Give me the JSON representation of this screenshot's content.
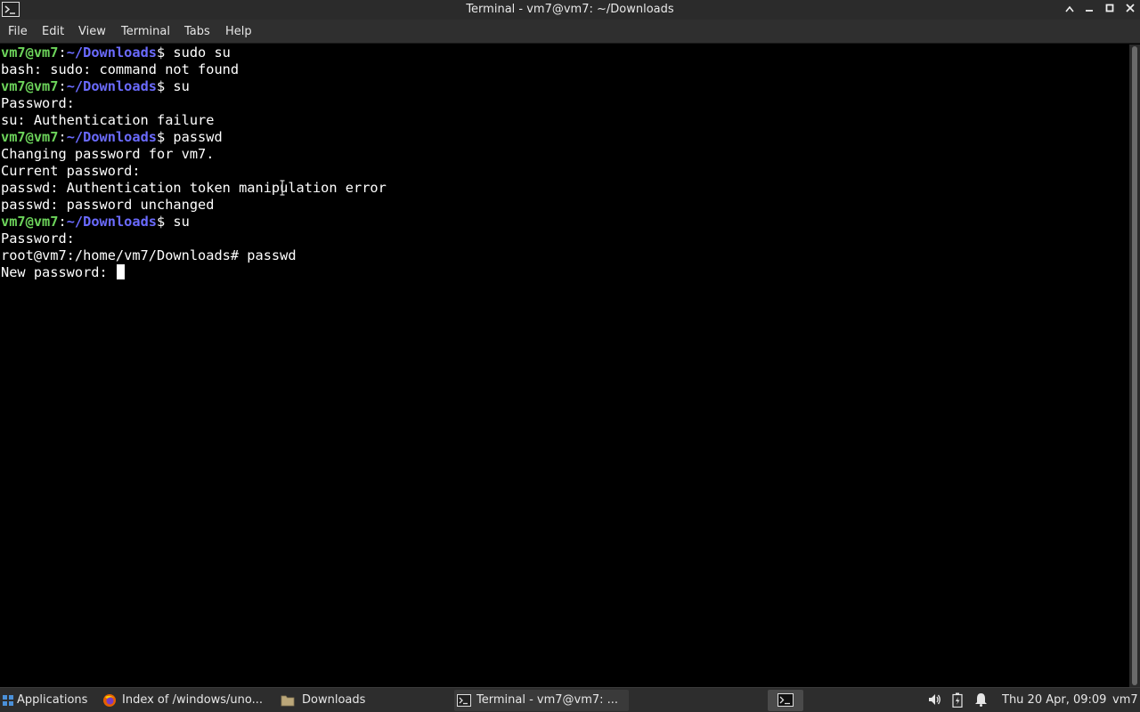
{
  "window": {
    "title": "Terminal - vm7@vm7: ~/Downloads"
  },
  "menus": [
    "File",
    "Edit",
    "View",
    "Terminal",
    "Tabs",
    "Help"
  ],
  "terminal": {
    "lines": [
      {
        "user": "vm7@vm7",
        "sep": ":",
        "path": "~/Downloads",
        "cmd": "$ sudo su"
      },
      {
        "text": "bash: sudo: command not found"
      },
      {
        "user": "vm7@vm7",
        "sep": ":",
        "path": "~/Downloads",
        "cmd": "$ su"
      },
      {
        "text": "Password:"
      },
      {
        "text": "su: Authentication failure"
      },
      {
        "user": "vm7@vm7",
        "sep": ":",
        "path": "~/Downloads",
        "cmd": "$ passwd"
      },
      {
        "text": "Changing password for vm7."
      },
      {
        "text": "Current password:"
      },
      {
        "text": "passwd: Authentication token manipulation error"
      },
      {
        "text": "passwd: password unchanged"
      },
      {
        "user": "vm7@vm7",
        "sep": ":",
        "path": "~/Downloads",
        "cmd": "$ su"
      },
      {
        "text": "Password:"
      },
      {
        "text": "root@vm7:/home/vm7/Downloads# passwd"
      },
      {
        "text": "New password: "
      }
    ]
  },
  "taskbar": {
    "applications_label": "Applications",
    "tasks": [
      {
        "label": "Index of /windows/uno...",
        "icon": "firefox-icon"
      },
      {
        "label": "Downloads",
        "icon": "folder-icon"
      },
      {
        "label": "Terminal - vm7@vm7: ...",
        "icon": "terminal-icon"
      }
    ],
    "clock": "Thu 20 Apr, 09:09",
    "user": "vm7"
  },
  "colors": {
    "prompt_user": "#6cd35a",
    "prompt_path": "#6b6bff",
    "terminal_bg": "#000000",
    "terminal_fg": "#ffffff"
  }
}
